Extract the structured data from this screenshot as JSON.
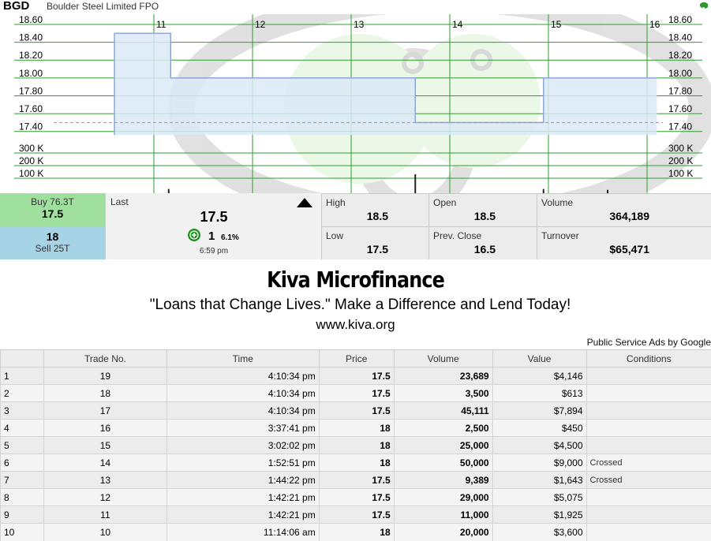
{
  "header": {
    "code": "BGD",
    "name": "Boulder Steel Limited FPO"
  },
  "chart_data": {
    "type": "area",
    "x_ticks": [
      "11",
      "12",
      "13",
      "14",
      "15",
      "16"
    ],
    "price_ticks": [
      "18.60",
      "18.40",
      "18.20",
      "18.00",
      "17.80",
      "17.60",
      "17.40"
    ],
    "volume_ticks": [
      "300 K",
      "200 K",
      "100 K"
    ],
    "price_ylim": [
      17.38,
      18.6
    ],
    "price_steps": [
      {
        "from": "10.6",
        "to": "11.17",
        "price": 18.5
      },
      {
        "from": "11.17",
        "to": "13.65",
        "price": 18.0
      },
      {
        "from": "13.65",
        "to": "14.95",
        "price": 17.5
      },
      {
        "from": "14.95",
        "to": "16.1",
        "price": 18.0
      }
    ],
    "prev_close_line": 17.5,
    "volume_bars": [
      {
        "x": "11.15",
        "v": 20000
      },
      {
        "x": "13.65",
        "v": 364189
      },
      {
        "x": "14.95",
        "v": 20000
      },
      {
        "x": "15.6",
        "v": 5000
      }
    ],
    "colors": {
      "grid": "#2e9e2e",
      "area": "#dbe9f7",
      "line": "#8fa8d9",
      "prev": "#999999"
    }
  },
  "bid": {
    "buy_label": "Buy 76.3T",
    "buy_value": "17.5",
    "sell_value": "18",
    "sell_label": "Sell 25T"
  },
  "last": {
    "label": "Last",
    "value": "17.5",
    "change": "1",
    "change_pct": "6.1%",
    "time": "6:59 pm"
  },
  "stats": {
    "high_label": "High",
    "high": "18.5",
    "open_label": "Open",
    "open": "18.5",
    "volume_label": "Volume",
    "volume": "364,189",
    "low_label": "Low",
    "low": "17.5",
    "prev_label": "Prev. Close",
    "prev": "16.5",
    "turnover_label": "Turnover",
    "turnover": "$65,471"
  },
  "ad": {
    "title": "Kiva Microfinance",
    "subtitle": "\"Loans that Change Lives.\" Make a Difference and Lend Today!",
    "url": "www.kiva.org",
    "attribution": "Public Service Ads by Google"
  },
  "table": {
    "headers": [
      "",
      "Trade No.",
      "Time",
      "Price",
      "Volume",
      "Value",
      "Conditions"
    ],
    "rows": [
      [
        "1",
        "19",
        "4:10:34 pm",
        "17.5",
        "23,689",
        "$4,146",
        ""
      ],
      [
        "2",
        "18",
        "4:10:34 pm",
        "17.5",
        "3,500",
        "$613",
        ""
      ],
      [
        "3",
        "17",
        "4:10:34 pm",
        "17.5",
        "45,111",
        "$7,894",
        ""
      ],
      [
        "4",
        "16",
        "3:37:41 pm",
        "18",
        "2,500",
        "$450",
        ""
      ],
      [
        "5",
        "15",
        "3:02:02 pm",
        "18",
        "25,000",
        "$4,500",
        ""
      ],
      [
        "6",
        "14",
        "1:52:51 pm",
        "18",
        "50,000",
        "$9,000",
        "Crossed"
      ],
      [
        "7",
        "13",
        "1:44:22 pm",
        "17.5",
        "9,389",
        "$1,643",
        "Crossed"
      ],
      [
        "8",
        "12",
        "1:42:21 pm",
        "17.5",
        "29,000",
        "$5,075",
        ""
      ],
      [
        "9",
        "11",
        "1:42:21 pm",
        "17.5",
        "11,000",
        "$1,925",
        ""
      ],
      [
        "10",
        "10",
        "11:14:06 am",
        "18",
        "20,000",
        "$3,600",
        ""
      ]
    ]
  }
}
